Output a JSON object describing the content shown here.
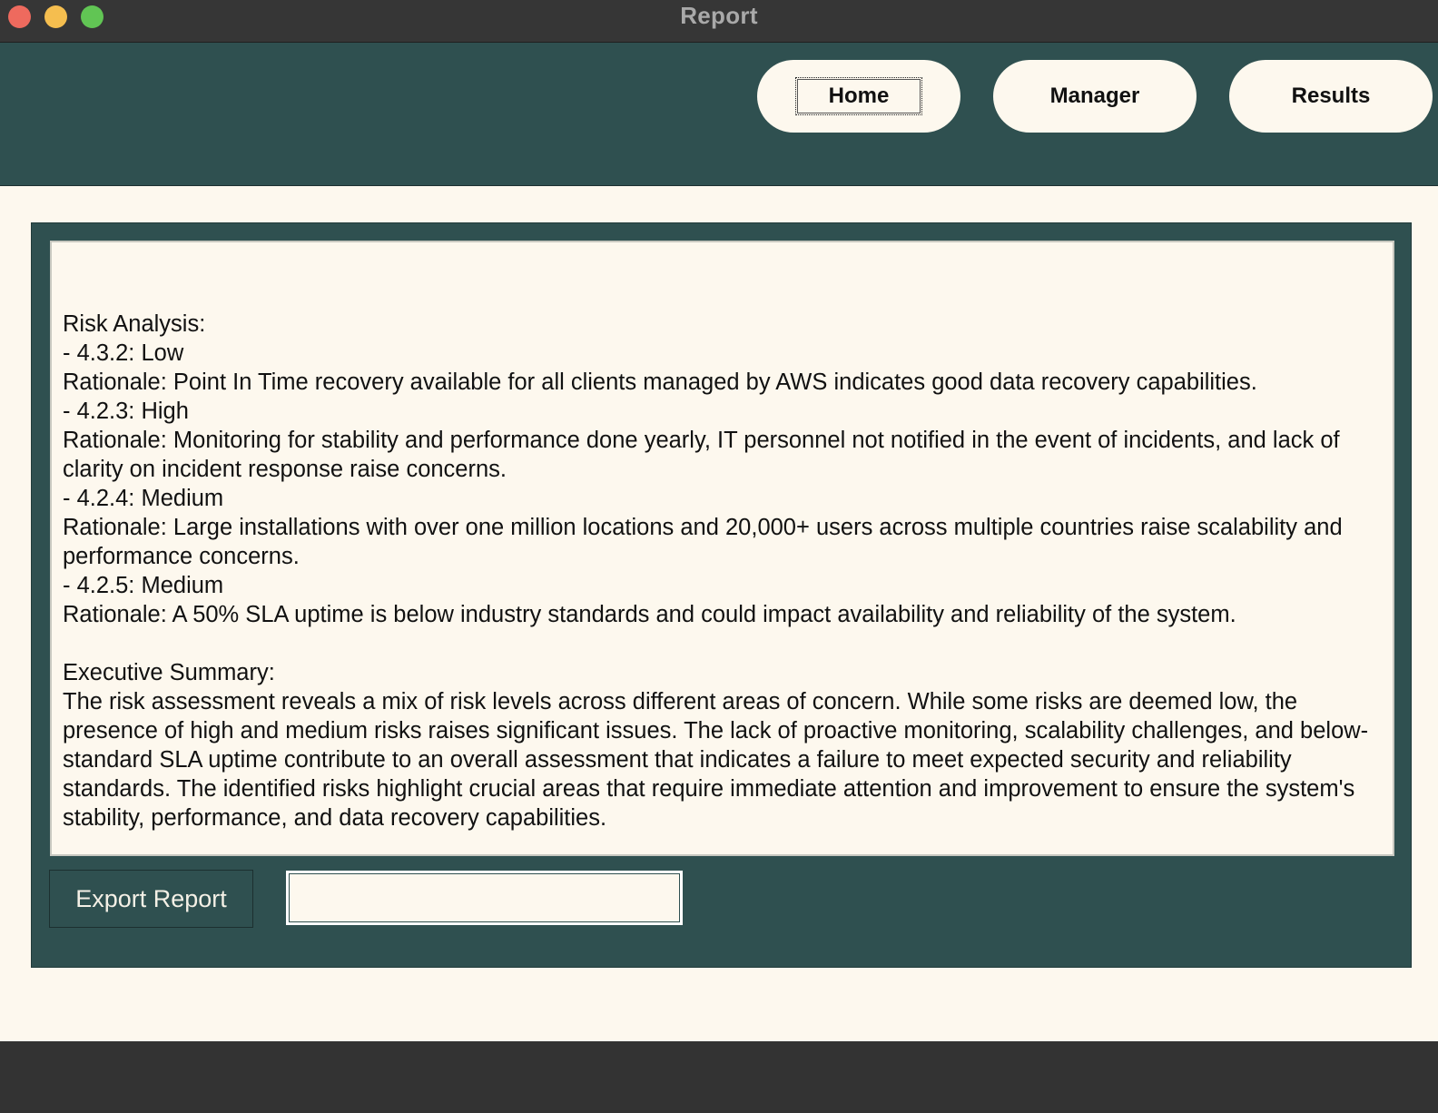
{
  "window": {
    "title": "Report"
  },
  "nav": {
    "home_label": "Home",
    "manager_label": "Manager",
    "results_label": "Results"
  },
  "report": {
    "lines": [
      "Risk Analysis:",
      "- 4.3.2: Low",
      "Rationale: Point In Time recovery available for all clients managed by AWS indicates good data recovery capabilities.",
      "- 4.2.3: High",
      "Rationale: Monitoring for stability and performance done yearly, IT personnel not notified in the event of incidents, and lack of clarity on incident response raise concerns.",
      "- 4.2.4: Medium",
      "Rationale: Large installations with over one million locations and 20,000+ users across multiple countries raise scalability and performance concerns.",
      "- 4.2.5: Medium",
      "Rationale: A 50% SLA uptime is below industry standards and could impact availability and reliability of the system.",
      "",
      "Executive Summary:",
      "The risk assessment reveals a mix of risk levels across different areas of concern. While some risks are deemed low, the presence of high and medium risks raises significant issues. The lack of proactive monitoring, scalability challenges, and below-standard SLA uptime contribute to an overall assessment that indicates a failure to meet expected security and reliability standards. The identified risks highlight crucial areas that require immediate attention and improvement to ensure the system's stability, performance, and data recovery capabilities."
    ]
  },
  "export": {
    "button_label": "Export Report",
    "filename_value": ""
  },
  "colors": {
    "header_bg": "#2f5050",
    "content_bg": "#fdf8ee",
    "titlebar_bg": "#363636"
  }
}
